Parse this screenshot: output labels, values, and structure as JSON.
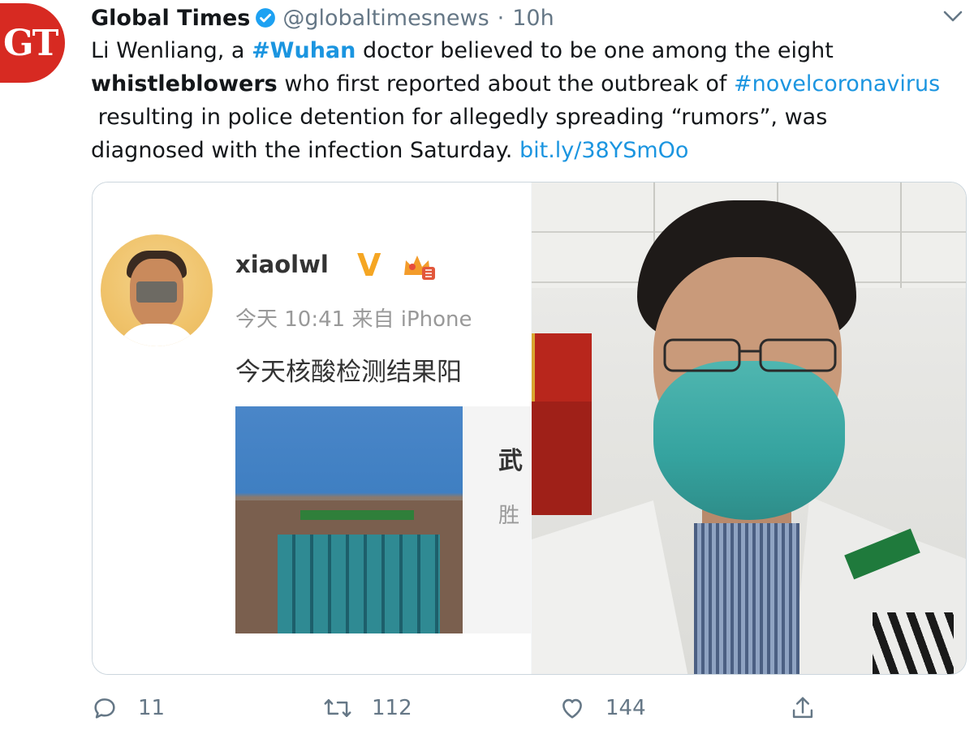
{
  "tweet": {
    "avatar_text": "GT",
    "display_name": "Global Times",
    "handle": "@globaltimesnews",
    "separator": "·",
    "time": "10h",
    "text": {
      "t1": "Li Wenliang, a ",
      "hashtag1": "#Wuhan",
      "t2": " doctor believed to be one among the eight\n",
      "bold1": "whistleblowers",
      "t3": " who first reported about the outbreak of ",
      "hashtag2": "#novelcoronavirus",
      "t4": "\n resulting in police detention for allegedly spreading “rumors”, was\ndiagnosed with the infection Saturday. ",
      "link": "bit.ly/38YSmOo"
    },
    "media": {
      "weibo_name": "xiaolwl",
      "weibo_v": "V",
      "weibo_meta": "今天 10:41 来自 iPhone",
      "weibo_post": "今天核酸检测结果阳",
      "card_title": "武",
      "card_sub": "胜"
    },
    "actions": {
      "reply_count": "11",
      "retweet_count": "112",
      "like_count": "144"
    }
  },
  "colors": {
    "link": "#1b95e0",
    "muted": "#657786",
    "brand_red": "#d72a22"
  },
  "icons": [
    "verified-badge-icon",
    "chevron-down-icon",
    "reply-icon",
    "retweet-icon",
    "like-icon",
    "share-icon"
  ]
}
